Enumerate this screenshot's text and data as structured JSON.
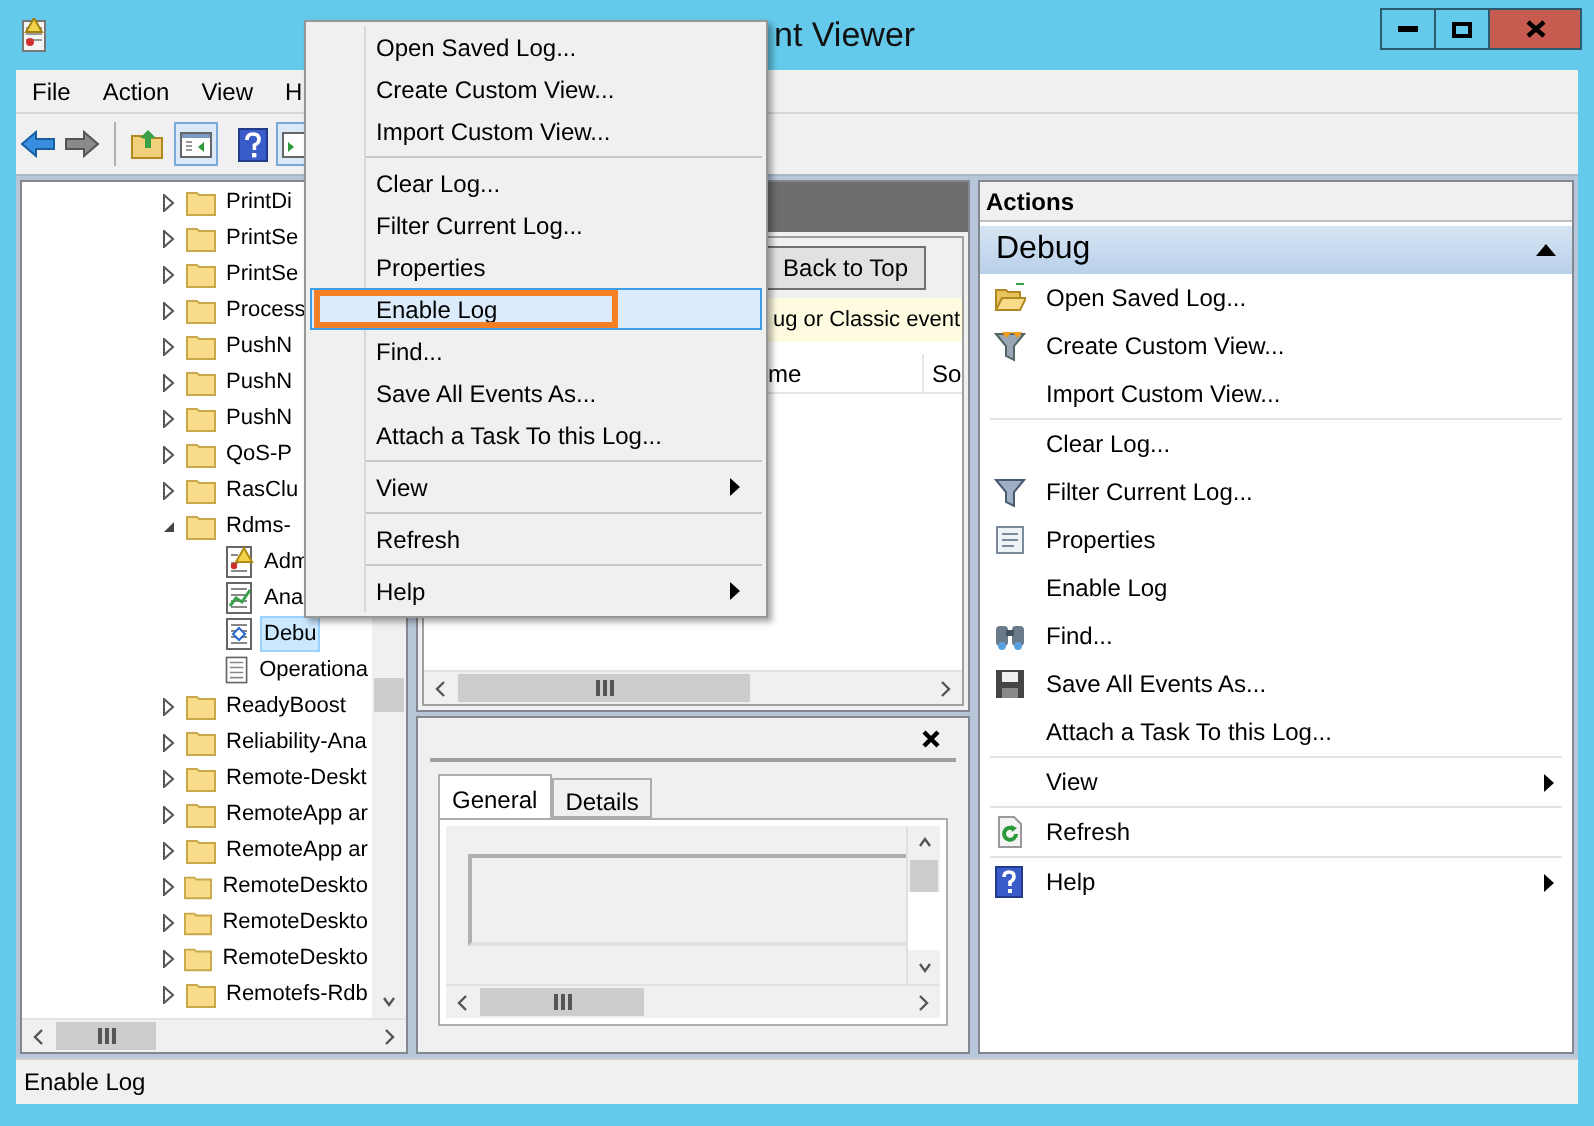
{
  "window": {
    "title": "nt Viewer"
  },
  "menu_bar": [
    "File",
    "Action",
    "View",
    "H"
  ],
  "tree": {
    "items": [
      {
        "label": "PrintDi",
        "expanded": false,
        "selected": false
      },
      {
        "label": "PrintSe",
        "expanded": false,
        "selected": false
      },
      {
        "label": "PrintSe",
        "expanded": false,
        "selected": false
      },
      {
        "label": "Process",
        "expanded": false,
        "selected": false
      },
      {
        "label": "PushN",
        "expanded": false,
        "selected": false
      },
      {
        "label": "PushN",
        "expanded": false,
        "selected": false
      },
      {
        "label": "PushN",
        "expanded": false,
        "selected": false
      },
      {
        "label": "QoS-P",
        "expanded": false,
        "selected": false
      },
      {
        "label": "RasClu",
        "expanded": false,
        "selected": false
      },
      {
        "label": "Rdms-",
        "expanded": true,
        "selected": false,
        "children": [
          {
            "label": "Adm",
            "kind": "admin",
            "selected": false
          },
          {
            "label": "Ana",
            "kind": "analytic",
            "selected": false
          },
          {
            "label": "Debu",
            "kind": "debug",
            "selected": true
          },
          {
            "label": "Operationa",
            "kind": "operational",
            "selected": false
          }
        ]
      },
      {
        "label": "ReadyBoost",
        "expanded": false,
        "selected": false
      },
      {
        "label": "Reliability-Ana",
        "expanded": false,
        "selected": false
      },
      {
        "label": "Remote-Deskt",
        "expanded": false,
        "selected": false
      },
      {
        "label": "RemoteApp ar",
        "expanded": false,
        "selected": false
      },
      {
        "label": "RemoteApp ar",
        "expanded": false,
        "selected": false
      },
      {
        "label": "RemoteDeskto",
        "expanded": false,
        "selected": false
      },
      {
        "label": "RemoteDeskto",
        "expanded": false,
        "selected": false
      },
      {
        "label": "RemoteDeskto",
        "expanded": false,
        "selected": false
      },
      {
        "label": "Remotefs-Rdb",
        "expanded": false,
        "selected": false
      }
    ]
  },
  "events_pane": {
    "back_button": "Back to Top",
    "info_bar": "ug or Classic event",
    "columns": [
      "me",
      "So"
    ]
  },
  "details_pane": {
    "tabs": [
      {
        "label": "General",
        "selected": true
      },
      {
        "label": "Details",
        "selected": false
      }
    ]
  },
  "actions_pane": {
    "title": "Actions",
    "section": {
      "title": "Debug",
      "expanded": true
    },
    "groups": [
      [
        {
          "label": "Open Saved Log...",
          "kind": "open",
          "submenu": false
        },
        {
          "label": "Create Custom View...",
          "kind": "custom-filter",
          "submenu": false
        },
        {
          "label": "Import Custom View...",
          "kind": "plain",
          "submenu": false
        }
      ],
      [
        {
          "label": "Clear Log...",
          "kind": "plain",
          "submenu": false
        },
        {
          "label": "Filter Current Log...",
          "kind": "filter",
          "submenu": false
        },
        {
          "label": "Properties",
          "kind": "properties",
          "submenu": false
        },
        {
          "label": "Enable Log",
          "kind": "plain",
          "submenu": false
        },
        {
          "label": "Find...",
          "kind": "find",
          "submenu": false
        },
        {
          "label": "Save All Events As...",
          "kind": "save",
          "submenu": false
        },
        {
          "label": "Attach a Task To this Log...",
          "kind": "plain",
          "submenu": false
        }
      ],
      [
        {
          "label": "View",
          "kind": "plain",
          "submenu": true
        }
      ],
      [
        {
          "label": "Refresh",
          "kind": "refresh",
          "submenu": false
        }
      ],
      [
        {
          "label": "Help",
          "kind": "help",
          "submenu": true
        }
      ]
    ]
  },
  "context_menu": {
    "groups": [
      [
        {
          "label": "Open Saved Log...",
          "selected": false,
          "submenu": false
        },
        {
          "label": "Create Custom View...",
          "selected": false,
          "submenu": false
        },
        {
          "label": "Import Custom View...",
          "selected": false,
          "submenu": false
        }
      ],
      [
        {
          "label": "Clear Log...",
          "selected": false,
          "submenu": false
        },
        {
          "label": "Filter Current Log...",
          "selected": false,
          "submenu": false
        },
        {
          "label": "Properties",
          "selected": false,
          "submenu": false
        },
        {
          "label": "Enable Log",
          "selected": true,
          "submenu": false
        },
        {
          "label": "Find...",
          "selected": false,
          "submenu": false
        },
        {
          "label": "Save All Events As...",
          "selected": false,
          "submenu": false
        },
        {
          "label": "Attach a Task To this Log...",
          "selected": false,
          "submenu": false
        }
      ],
      [
        {
          "label": "View",
          "selected": false,
          "submenu": true
        }
      ],
      [
        {
          "label": "Refresh",
          "selected": false,
          "submenu": false
        }
      ],
      [
        {
          "label": "Help",
          "selected": false,
          "submenu": true
        }
      ]
    ]
  },
  "status_bar": "Enable Log"
}
